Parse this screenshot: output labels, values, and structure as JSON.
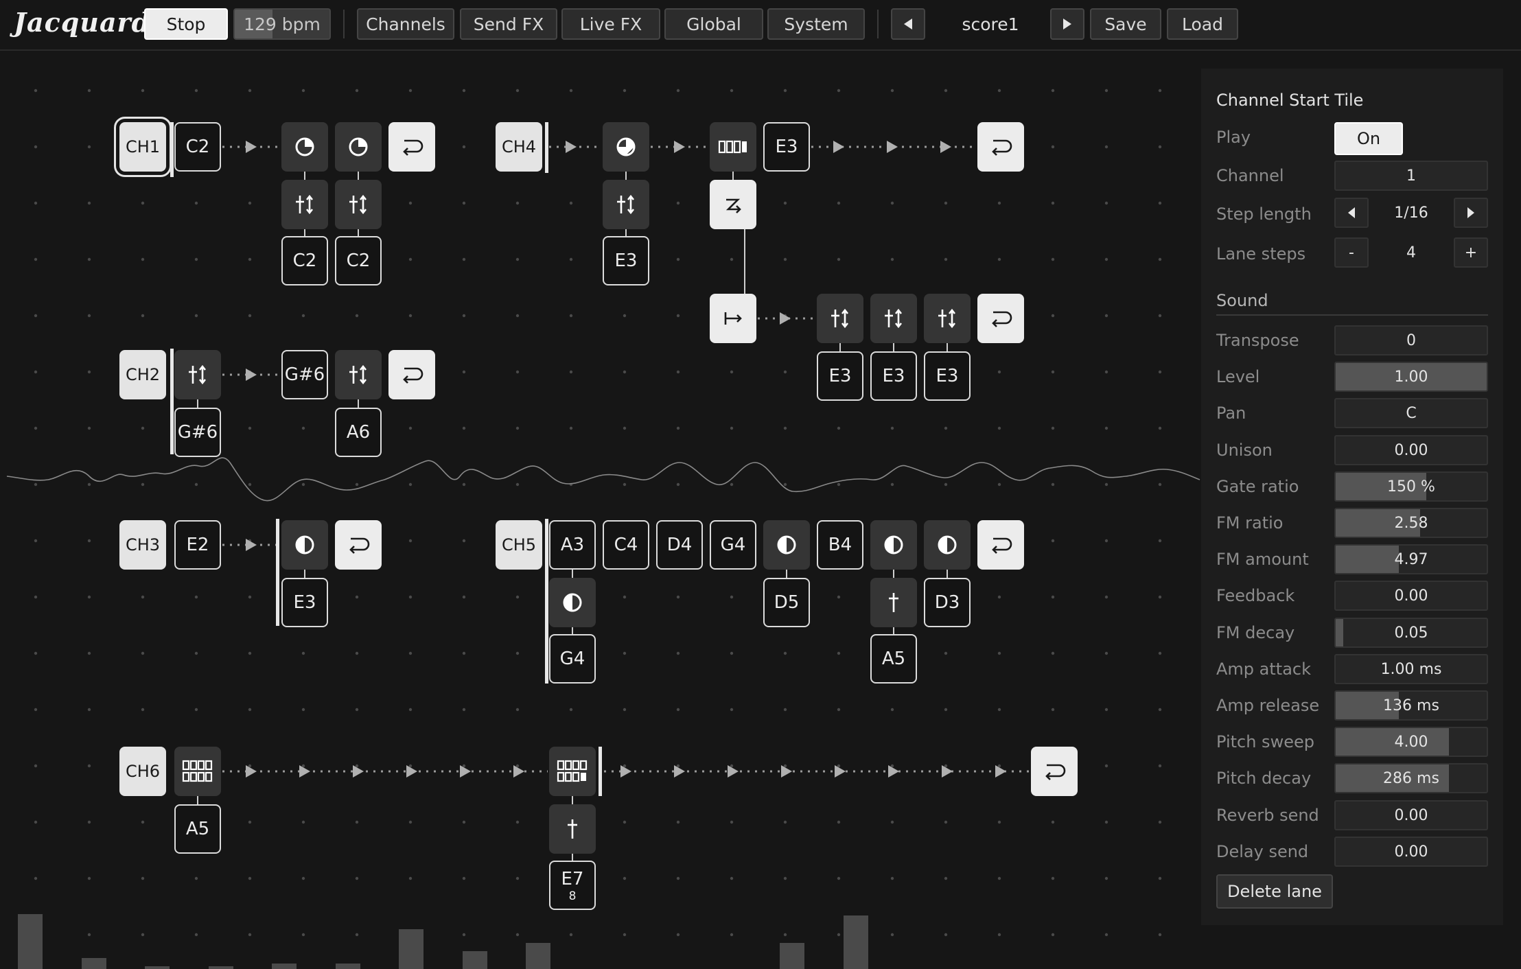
{
  "app": {
    "logo": "Jacquard"
  },
  "toolbar": {
    "stop_label": "Stop",
    "bpm_label": "129 bpm",
    "bpm_fraction": 0.4,
    "menus": [
      "Channels",
      "Send FX",
      "Live FX",
      "Global",
      "System"
    ],
    "score_name": "score1",
    "save_label": "Save",
    "load_label": "Load"
  },
  "tiles": {
    "ch1": "CH1",
    "ch1_note": "C2",
    "ch1_n1": "C2",
    "ch1_n2": "C2",
    "ch2": "CH2",
    "ch2_n1": "G#6",
    "ch2_n2": "G#6",
    "ch2_n3": "A6",
    "ch3": "CH3",
    "ch3_n1": "E2",
    "ch3_n2": "E3",
    "ch4": "CH4",
    "ch4_n1": "E3",
    "ch4_n2": "E3",
    "ch4_b1": "E3",
    "ch4_b2": "E3",
    "ch4_b3": "E3",
    "ch5": "CH5",
    "ch5_a3": "A3",
    "ch5_c4": "C4",
    "ch5_d4": "D4",
    "ch5_g4": "G4",
    "ch5_b4": "B4",
    "ch5_g4b": "G4",
    "ch5_d5": "D5",
    "ch5_a5": "A5",
    "ch5_d3": "D3",
    "ch6": "CH6",
    "ch6_a5": "A5",
    "ch6_e7": "E7",
    "ch6_e7_sub": "8"
  },
  "panel": {
    "title": "Channel Start Tile",
    "play_label": "Play",
    "play_value": "On",
    "channel_label": "Channel",
    "channel_value": "1",
    "step_length_label": "Step length",
    "step_length_value": "1/16",
    "lane_steps_label": "Lane steps",
    "lane_steps_value": "4",
    "minus": "-",
    "plus": "+",
    "sound_section": "Sound",
    "params": [
      {
        "label": "Transpose",
        "value": "0",
        "fill": 0.0
      },
      {
        "label": "Level",
        "value": "1.00",
        "fill": 1.0
      },
      {
        "label": "Pan",
        "value": "C",
        "fill": 0.0
      },
      {
        "label": "Unison",
        "value": "0.00",
        "fill": 0.0
      },
      {
        "label": "Gate ratio",
        "value": "150 %",
        "fill": 0.6
      },
      {
        "label": "FM ratio",
        "value": "2.58",
        "fill": 0.56
      },
      {
        "label": "FM amount",
        "value": "4.97",
        "fill": 0.42
      },
      {
        "label": "Feedback",
        "value": "0.00",
        "fill": 0.0
      },
      {
        "label": "FM decay",
        "value": "0.05",
        "fill": 0.05
      },
      {
        "label": "Amp attack",
        "value": "1.00 ms",
        "fill": 0.0
      },
      {
        "label": "Amp release",
        "value": "136 ms",
        "fill": 0.42
      },
      {
        "label": "Pitch sweep",
        "value": "4.00",
        "fill": 0.75
      },
      {
        "label": "Pitch decay",
        "value": "286 ms",
        "fill": 0.75
      },
      {
        "label": "Reverb send",
        "value": "0.00",
        "fill": 0.0
      },
      {
        "label": "Delay send",
        "value": "0.00",
        "fill": 0.0
      }
    ],
    "delete_label": "Delete lane"
  },
  "meters": [
    0.67,
    0.13,
    0.02,
    0.03,
    0.07,
    0.07,
    0.48,
    0.22,
    0.32,
    0.0,
    0.0,
    0.0,
    0.32,
    0.65
  ]
}
